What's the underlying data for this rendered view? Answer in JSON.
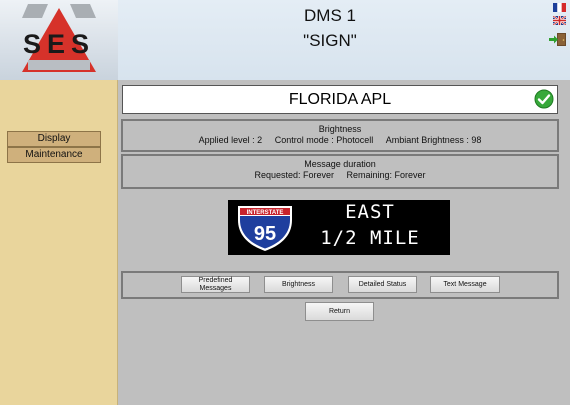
{
  "header": {
    "logo_text": "SES",
    "title_line1": "DMS 1",
    "title_line2": "\"SIGN\"",
    "icons": [
      "french-flag-icon",
      "uk-flag-icon",
      "logout-door-icon"
    ]
  },
  "sidebar": {
    "items": [
      {
        "label": "Display"
      },
      {
        "label": "Maintenance"
      }
    ]
  },
  "sign": {
    "name": "FLORIDA APL",
    "status_icon": "ok-check-icon"
  },
  "brightness": {
    "title": "Brightness",
    "applied": "Applied level : 2",
    "control": "Control mode : Photocell",
    "ambient": "Ambiant Brightness : 98"
  },
  "duration": {
    "title": "Message duration",
    "requested": "Requested: Forever",
    "remaining": "Remaining: Forever"
  },
  "display": {
    "shield_top": "INTERSTATE",
    "shield_number": "95",
    "line1": "EAST",
    "line2": "1/2 MILE"
  },
  "buttons": {
    "predefined_line1": "Predefined",
    "predefined_line2": "Messages",
    "brightness": "Brightness",
    "detailed": "Detailed Status",
    "text_message": "Text Message",
    "return": "Return"
  },
  "colors": {
    "sidebar": "#e9d59c",
    "main": "#bfbfbf",
    "header": "#d7e3ee",
    "logo_red": "#d6322a"
  }
}
